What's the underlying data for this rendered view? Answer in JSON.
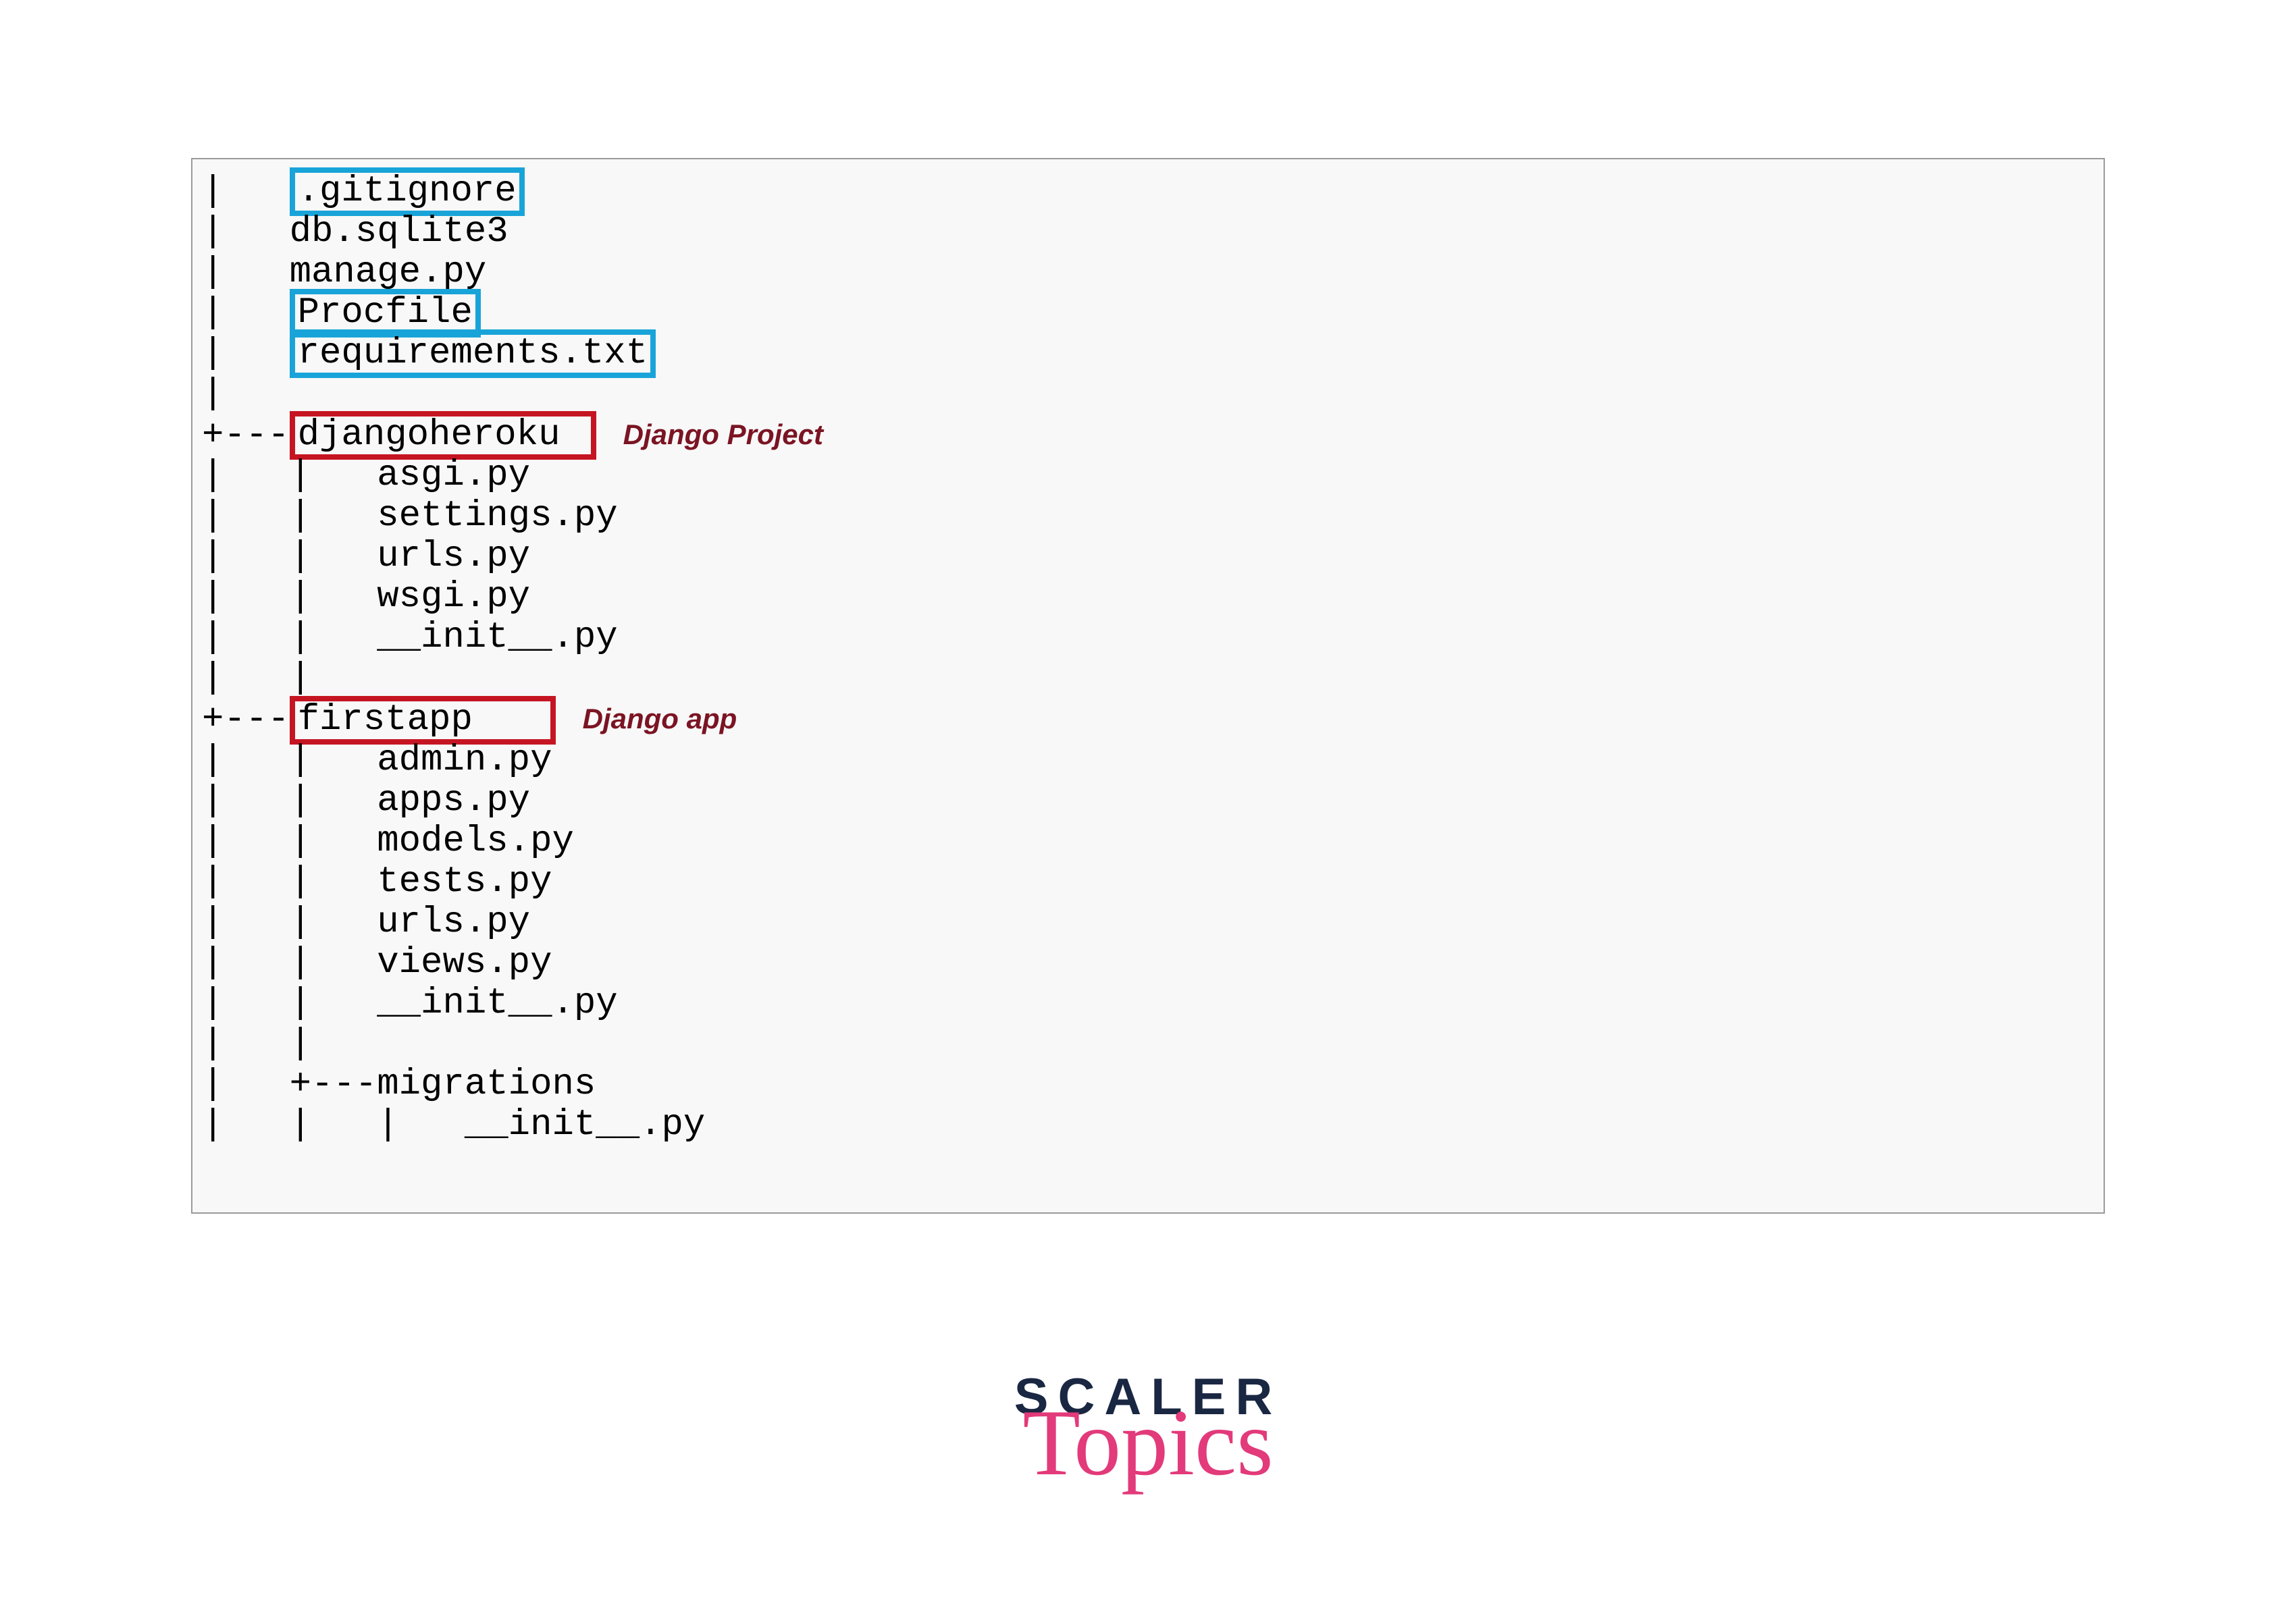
{
  "lines": [
    {
      "prefix": "|   ",
      "name": ".gitignore",
      "highlight": "blue"
    },
    {
      "prefix": "|   ",
      "name": "db.sqlite3"
    },
    {
      "prefix": "|   ",
      "name": "manage.py"
    },
    {
      "prefix": "|   ",
      "name": "Procfile",
      "highlight": "blue"
    },
    {
      "prefix": "|   ",
      "name": "requirements.txt",
      "highlight": "blue"
    },
    {
      "prefix": "|"
    },
    {
      "prefix": "+---",
      "name": "djangoheroku",
      "highlight": "red",
      "hlClass": "wider",
      "annotation": "Django Project"
    },
    {
      "prefix": "|   |   ",
      "name": "asgi.py"
    },
    {
      "prefix": "|   |   ",
      "name": "settings.py"
    },
    {
      "prefix": "|   |   ",
      "name": "urls.py"
    },
    {
      "prefix": "|   |   ",
      "name": "wsgi.py"
    },
    {
      "prefix": "|   |   ",
      "name": "__init__.py"
    },
    {
      "prefix": "|   |"
    },
    {
      "prefix": "+---",
      "name": "firstapp",
      "highlight": "red",
      "annotation": "Django app"
    },
    {
      "prefix": "|   |   ",
      "name": "admin.py"
    },
    {
      "prefix": "|   |   ",
      "name": "apps.py"
    },
    {
      "prefix": "|   |   ",
      "name": "models.py"
    },
    {
      "prefix": "|   |   ",
      "name": "tests.py"
    },
    {
      "prefix": "|   |   ",
      "name": "urls.py"
    },
    {
      "prefix": "|   |   ",
      "name": "views.py"
    },
    {
      "prefix": "|   |   ",
      "name": "__init__.py"
    },
    {
      "prefix": "|   |"
    },
    {
      "prefix": "|   +---",
      "name": "migrations"
    },
    {
      "prefix": "|   |   |   ",
      "name": "__init__.py"
    }
  ],
  "logo": {
    "top": "SCALER",
    "bottom": "Topics"
  }
}
